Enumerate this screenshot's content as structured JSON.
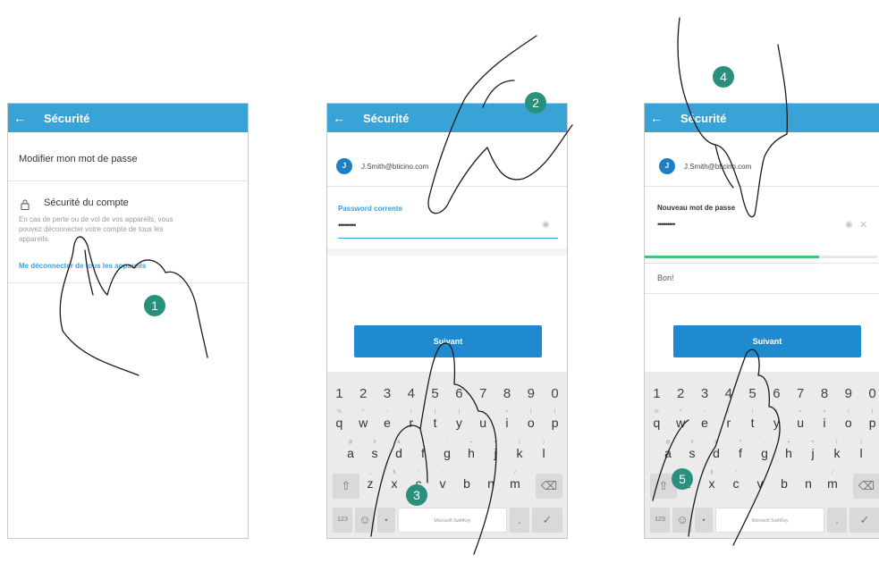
{
  "screens": [
    {
      "app_bar": {
        "back_icon": "arrow-left-icon",
        "title": "Sécurité"
      },
      "change_password_label": "Modifier mon mot de passe",
      "account_security": {
        "icon": "lock-icon",
        "label": "Sécurité du compte",
        "description_lines": [
          "En cas de perte ou de vol de vos appareils, vous",
          "pouvez déconnecter votre compte de tous les",
          "appareils."
        ],
        "link": "Me déconnecter de tous les appareils"
      }
    },
    {
      "app_bar": {
        "back_icon": "arrow-left-icon",
        "title": "Sécurité"
      },
      "avatar_initial": "J",
      "email": "J.Smith@bticino.com",
      "field_label": "Password corrente",
      "field_value": "•••••••••",
      "eye_icon": "eye-icon",
      "next_button": "Suivant"
    },
    {
      "app_bar": {
        "back_icon": "arrow-left-icon",
        "title": "Sécurité"
      },
      "avatar_initial": "J",
      "email": "J.Smith@bticino.com",
      "field_label": "Nouveau mot de passe",
      "field_value": "•••••••••",
      "eye_icon": "eye-icon",
      "clear_icon": "close-icon",
      "strength_fraction": 0.75,
      "strength_color": "#3fc47a",
      "strength_label": "Bon!",
      "next_button": "Suivant"
    }
  ],
  "keyboard": {
    "numbers": [
      "1",
      "2",
      "3",
      "4",
      "5",
      "6",
      "7",
      "8",
      "9",
      "0"
    ],
    "row1": [
      "q",
      "w",
      "e",
      "r",
      "t",
      "y",
      "u",
      "i",
      "o",
      "p"
    ],
    "row1_sub": [
      "%",
      "^",
      "~",
      "|",
      "[",
      "]",
      "<",
      ">",
      "{",
      "}"
    ],
    "row2": [
      "a",
      "s",
      "d",
      "f",
      "g",
      "h",
      "j",
      "k",
      "l"
    ],
    "row2_sub": [
      "@",
      "#",
      "&",
      "*",
      "-",
      "+",
      "=",
      "(",
      ")"
    ],
    "row3": [
      "z",
      "x",
      "c",
      "v",
      "b",
      "n",
      "m"
    ],
    "row3_sub": [
      "_",
      "$",
      "\"",
      "'",
      ":",
      ";",
      "/"
    ],
    "shift_icon": "shift-icon",
    "backspace_icon": "backspace-icon",
    "symbols_key": "123",
    "emoji_icon": "emoji-icon",
    "mic_icon": "mic-icon",
    "space_label": "Microsoft SwiftKey",
    "enter_icon": "check-icon"
  },
  "steps": [
    "1",
    "2",
    "3",
    "4",
    "5"
  ],
  "colors": {
    "app_bar": "#39a3d8",
    "button": "#1f8ad0",
    "badge": "#2b8f7d",
    "link": "#39a3d8"
  }
}
